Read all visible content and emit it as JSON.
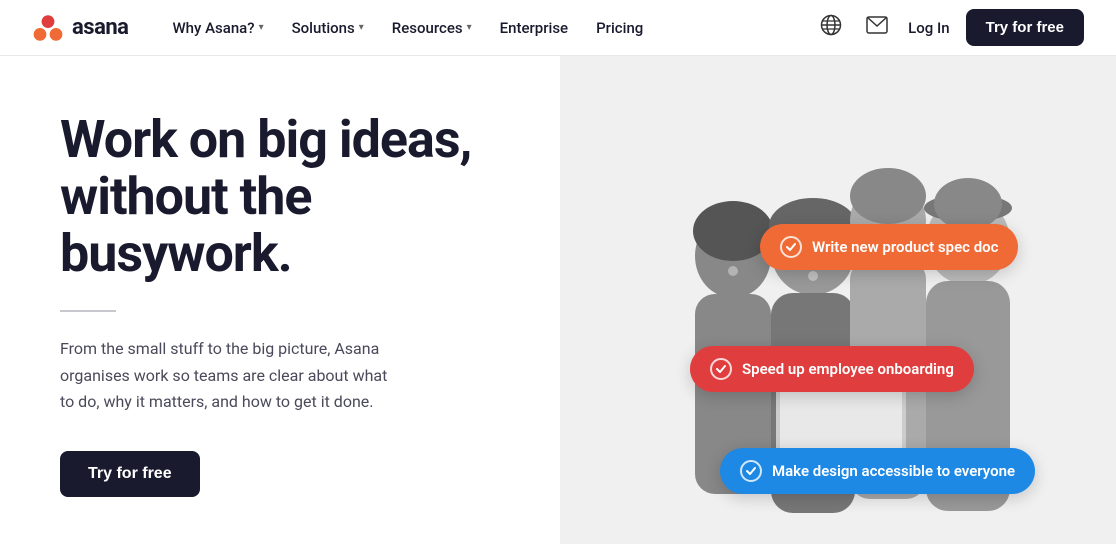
{
  "nav": {
    "logo_text": "asana",
    "links": [
      {
        "label": "Why Asana?",
        "has_dropdown": true
      },
      {
        "label": "Solutions",
        "has_dropdown": true
      },
      {
        "label": "Resources",
        "has_dropdown": true
      },
      {
        "label": "Enterprise",
        "has_dropdown": false
      },
      {
        "label": "Pricing",
        "has_dropdown": false
      }
    ],
    "login_label": "Log In",
    "cta_label": "Try for free"
  },
  "hero": {
    "title_line1": "Work on big ideas,",
    "title_line2": "without the busywork.",
    "description": "From the small stuff to the big picture, Asana organises work so teams are clear about what to do, why it matters, and how to get it done.",
    "cta_label": "Try for free"
  },
  "badges": [
    {
      "id": "badge-1",
      "label": "Write new product spec doc",
      "color": "#f06a35"
    },
    {
      "id": "badge-2",
      "label": "Speed up employee onboarding",
      "color": "#e03e3e"
    },
    {
      "id": "badge-3",
      "label": "Make design accessible to everyone",
      "color": "#1e88e5"
    }
  ],
  "colors": {
    "nav_bg": "#ffffff",
    "cta_bg": "#1a1a2e",
    "right_panel_bg": "#eeeeee"
  }
}
